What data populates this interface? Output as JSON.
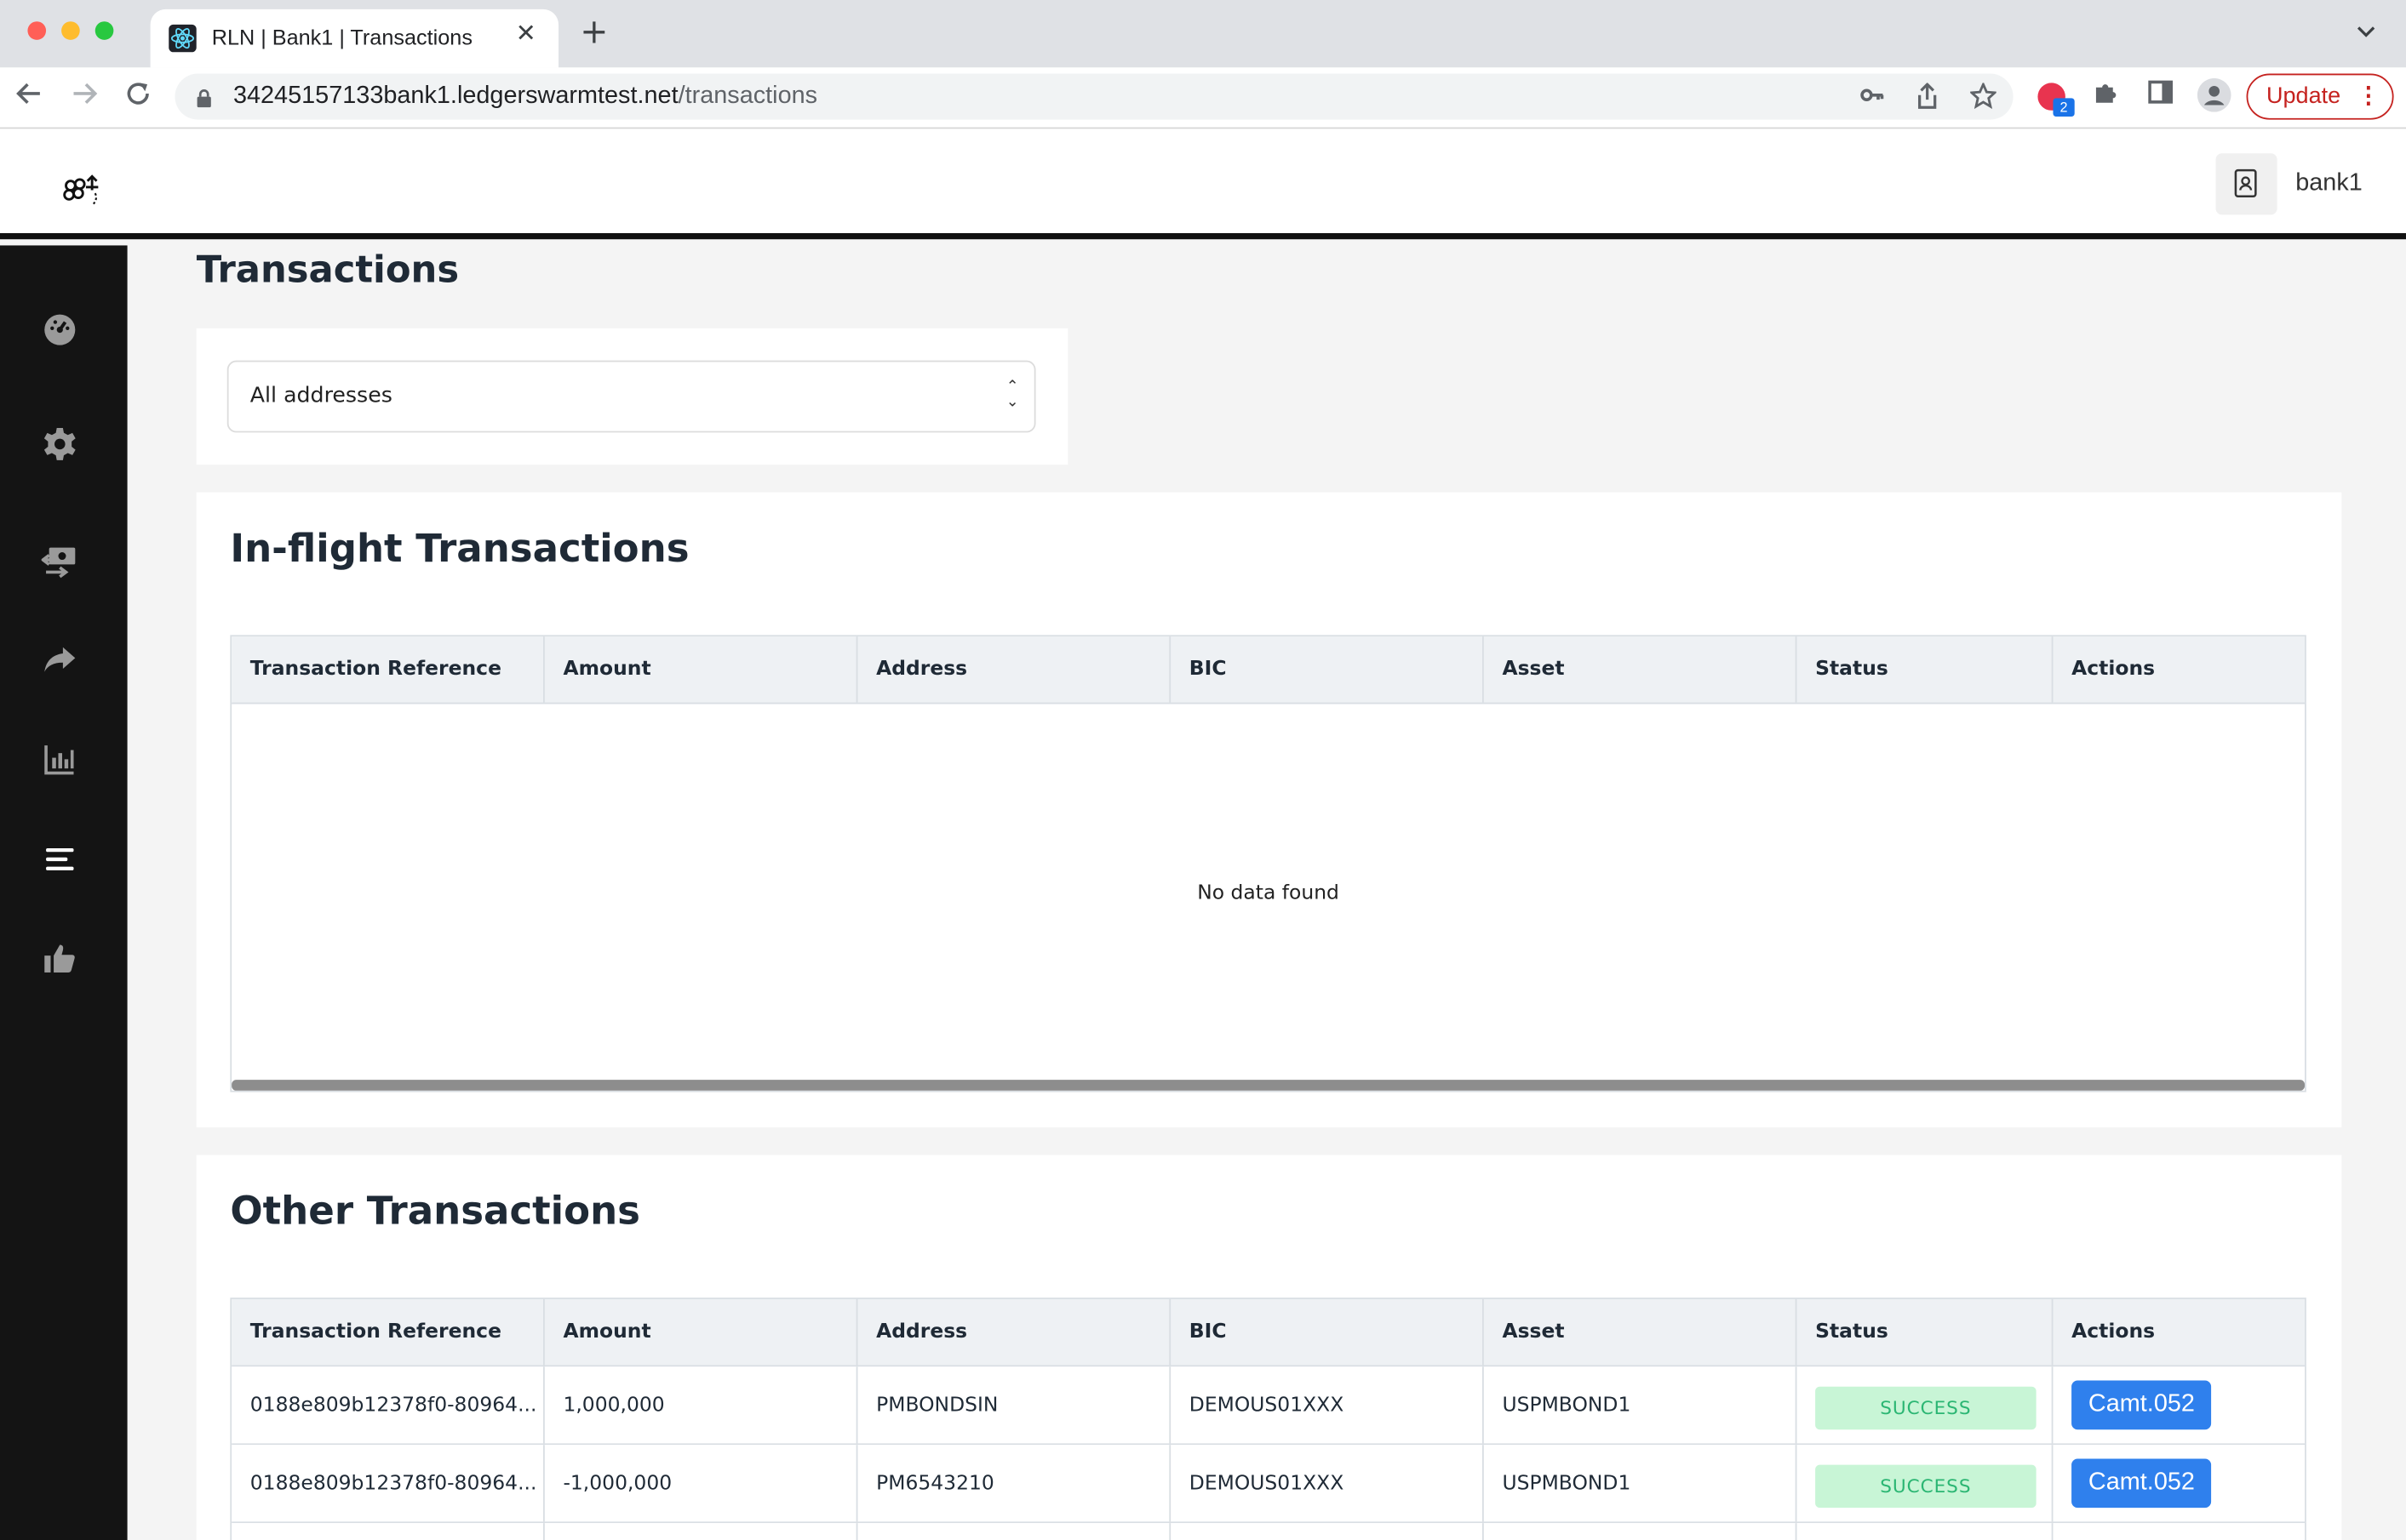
{
  "browser": {
    "tab_title": "RLN | Bank1 | Transactions",
    "tab_close": "✕",
    "new_tab": "+",
    "url_host": "34245157133bank1.ledgerswarmtest.net",
    "url_path": "/transactions",
    "update_label": "Update",
    "extension_badge": "2"
  },
  "header": {
    "user": "bank1"
  },
  "sidebar": {
    "items": [
      {
        "icon": "dashboard-icon"
      },
      {
        "icon": "settings-icon"
      },
      {
        "icon": "money-transfer-icon"
      },
      {
        "icon": "share-arrow-icon"
      },
      {
        "icon": "bar-chart-icon"
      },
      {
        "icon": "transactions-list-icon",
        "active": true
      },
      {
        "icon": "thumbs-up-icon"
      }
    ]
  },
  "page": {
    "title": "Transactions",
    "address_filter": "All addresses"
  },
  "columns": [
    "Transaction Reference",
    "Amount",
    "Address",
    "BIC",
    "Asset",
    "Status",
    "Actions"
  ],
  "inflight": {
    "title": "In-flight Transactions",
    "empty_text": "No data found"
  },
  "other": {
    "title": "Other Transactions",
    "rows": [
      {
        "ref": "0188e809b12378f0-80964...",
        "amount": "1,000,000",
        "address": "PMBONDSIN",
        "bic": "DEMOUS01XXX",
        "asset": "USPMBOND1",
        "status": "SUCCESS",
        "action": "Camt.052"
      },
      {
        "ref": "0188e809b12378f0-80964...",
        "amount": "-1,000,000",
        "address": "PM6543210",
        "bic": "DEMOUS01XXX",
        "asset": "USPMBOND1",
        "status": "SUCCESS",
        "action": "Camt.052"
      }
    ]
  },
  "colors": {
    "sidebar_bg": "#141414",
    "accent_button": "#2f80ed",
    "success_bg": "#c8f5d6",
    "success_text": "#2bb673"
  }
}
